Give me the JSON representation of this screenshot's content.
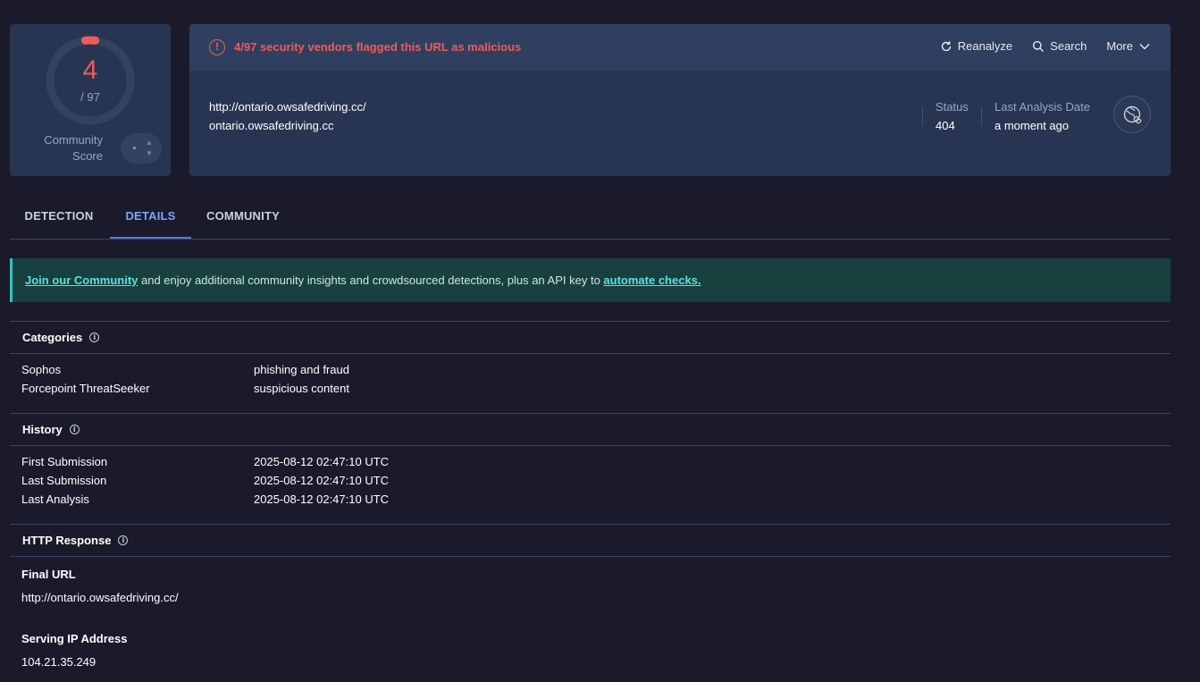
{
  "score": {
    "detections": "4",
    "total": "/ 97",
    "detected_fraction": 0.04,
    "community_label": "Community Score"
  },
  "alert": {
    "text": "4/97 security vendors flagged this URL as malicious",
    "color": "#f05a5a"
  },
  "actions": {
    "reanalyze": "Reanalyze",
    "search": "Search",
    "more": "More"
  },
  "target": {
    "url": "http://ontario.owsafedriving.cc/",
    "host": "ontario.owsafedriving.cc"
  },
  "meta": {
    "status_label": "Status",
    "status_value": "404",
    "date_label": "Last Analysis Date",
    "date_value": "a moment ago"
  },
  "tabs": [
    {
      "label": "DETECTION"
    },
    {
      "label": "DETAILS"
    },
    {
      "label": "COMMUNITY"
    }
  ],
  "active_tab": "DETAILS",
  "banner": {
    "link1": "Join our Community",
    "middle": " and enjoy additional community insights and crowdsourced detections, plus an API key to ",
    "link2": "automate checks."
  },
  "categories": {
    "title": "Categories",
    "rows": [
      {
        "k": "Sophos",
        "v": "phishing and fraud"
      },
      {
        "k": "Forcepoint ThreatSeeker",
        "v": "suspicious content"
      }
    ]
  },
  "history": {
    "title": "History",
    "rows": [
      {
        "k": "First Submission",
        "v": "2025-08-12 02:47:10 UTC"
      },
      {
        "k": "Last Submission",
        "v": "2025-08-12 02:47:10 UTC"
      },
      {
        "k": "Last Analysis",
        "v": "2025-08-12 02:47:10 UTC"
      }
    ]
  },
  "http": {
    "title": "HTTP Response",
    "final_url_label": "Final URL",
    "final_url": "http://ontario.owsafedriving.cc/",
    "ip_label": "Serving IP Address",
    "ip": "104.21.35.249"
  },
  "icons": {
    "alert": "alert-circle-icon",
    "reanalyze": "refresh-icon",
    "search": "search-icon",
    "more": "chevron-down-icon",
    "info": "info-icon",
    "globe": "globe-link-icon"
  }
}
